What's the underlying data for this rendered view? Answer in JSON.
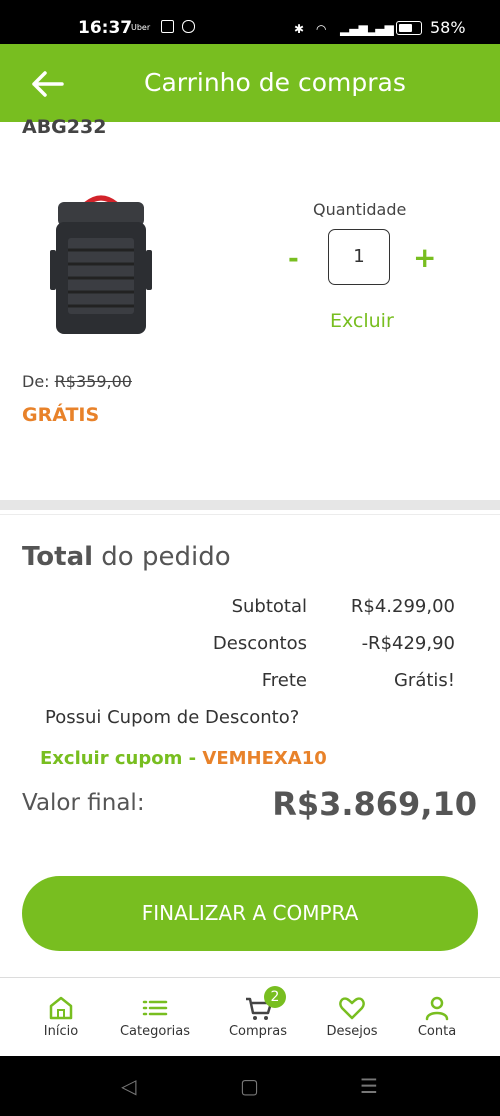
{
  "status_bar": {
    "time": "16:37",
    "uber": "Uber",
    "battery": "58%"
  },
  "header": {
    "title": "Carrinho de compras"
  },
  "product": {
    "sku": "ABG232",
    "quantity_label": "Quantidade",
    "quantity": "1",
    "minus": "-",
    "plus": "+",
    "remove_label": "Excluir",
    "old_price_prefix": "De:",
    "old_price": "R$359,00",
    "price": "GRÁTIS"
  },
  "order": {
    "title_bold": "Total",
    "title_rest": "do pedido",
    "subtotal_label": "Subtotal",
    "subtotal_value": "R$4.299,00",
    "discount_label": "Descontos",
    "discount_value": "-R$429,90",
    "shipping_label": "Frete",
    "shipping_value": "Grátis!",
    "coupon_question": "Possui Cupom de Desconto?",
    "coupon_remove": "Excluir cupom -",
    "coupon_code": "VEMHEXA10",
    "final_label": "Valor final:",
    "final_value": "R$3.869,10"
  },
  "checkout_button": "FINALIZAR A COMPRA",
  "bottom_nav": {
    "home": "Início",
    "categories": "Categorias",
    "cart": "Compras",
    "cart_badge": "2",
    "wishlist": "Desejos",
    "account": "Conta"
  },
  "colors": {
    "brand_green": "#78be20",
    "accent_orange": "#e8822a"
  }
}
